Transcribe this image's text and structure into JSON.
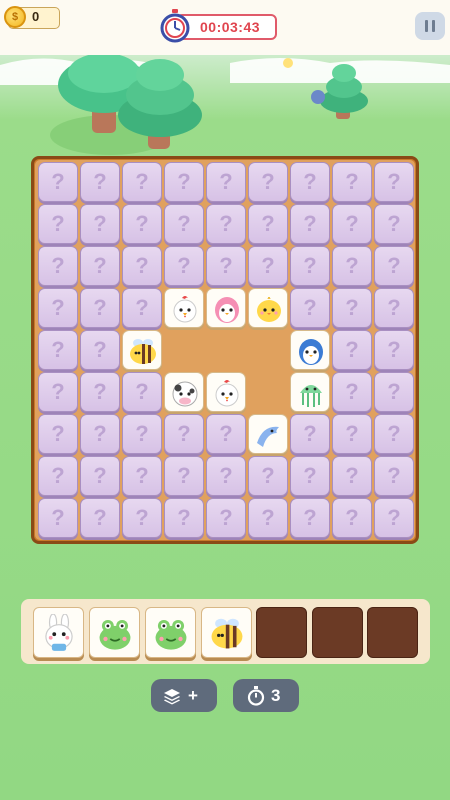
{
  "hud": {
    "coins": "0",
    "coin_symbol": "$",
    "timer": "00:03:43"
  },
  "board": {
    "rows": 9,
    "cols": 9,
    "hidden_symbol": "?",
    "open_tiles": [
      {
        "row": 3,
        "col": 3,
        "animal": "chicken"
      },
      {
        "row": 3,
        "col": 4,
        "animal": "pink-penguin"
      },
      {
        "row": 3,
        "col": 5,
        "animal": "yellow-chick"
      },
      {
        "row": 4,
        "col": 2,
        "animal": "bee"
      },
      {
        "row": 4,
        "col": 6,
        "animal": "penguin"
      },
      {
        "row": 5,
        "col": 3,
        "animal": "cow"
      },
      {
        "row": 5,
        "col": 4,
        "animal": "chicken"
      },
      {
        "row": 5,
        "col": 6,
        "animal": "jellyfish"
      },
      {
        "row": 6,
        "col": 5,
        "animal": "dolphin"
      }
    ],
    "empty_cells": [
      {
        "row": 4,
        "col": 3
      },
      {
        "row": 4,
        "col": 4
      },
      {
        "row": 4,
        "col": 5
      },
      {
        "row": 5,
        "col": 5
      }
    ]
  },
  "tray": {
    "capacity": 7,
    "items": [
      "rabbit",
      "frog",
      "frog",
      "bee"
    ]
  },
  "powerups": {
    "shuffle_label": "+",
    "shuffle_icon": "layers-icon",
    "time_count": "3",
    "time_icon": "stopwatch-icon"
  },
  "colors": {
    "hidden_tile": "#d7c2e6",
    "board": "#c8782a",
    "slot_empty": "#6b3a25",
    "timer_accent": "#e0454f"
  }
}
